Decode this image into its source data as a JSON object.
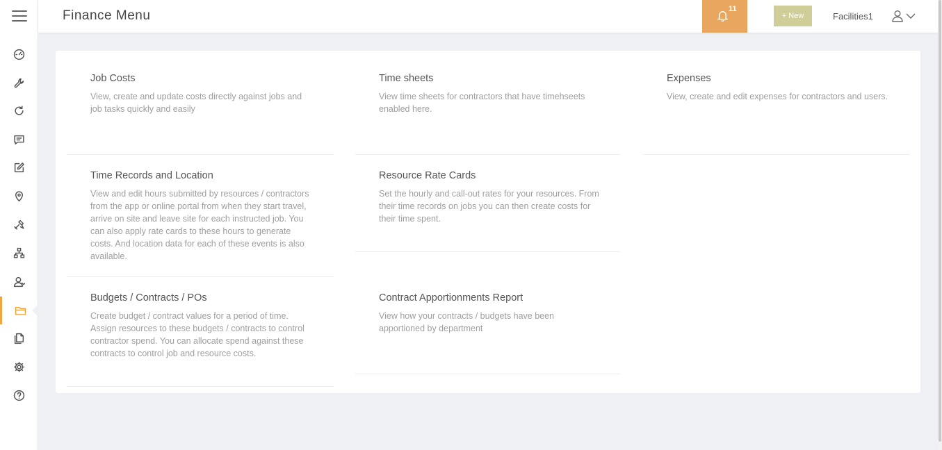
{
  "header": {
    "title": "Finance Menu",
    "notifications_count": "11",
    "new_label": "+ New",
    "user_name": "Facilities1"
  },
  "sidebar": {
    "items": [
      {
        "icon": "dashboard-icon"
      },
      {
        "icon": "wrench-icon"
      },
      {
        "icon": "refresh-icon"
      },
      {
        "icon": "message-icon"
      },
      {
        "icon": "edit-icon"
      },
      {
        "icon": "location-pin-icon"
      },
      {
        "icon": "tools-icon"
      },
      {
        "icon": "hierarchy-icon"
      },
      {
        "icon": "contractor-icon"
      },
      {
        "icon": "folder-icon",
        "active": true
      },
      {
        "icon": "documents-icon"
      },
      {
        "icon": "gear-icon"
      },
      {
        "icon": "help-icon"
      }
    ]
  },
  "colors": {
    "accent": "#f0a541",
    "bell_bg": "#e8a65f",
    "new_bg": "#cfcd98"
  },
  "menu": [
    {
      "title": "Job Costs",
      "description": "View, create and update costs directly against jobs and job tasks quickly and easily"
    },
    {
      "title": "Time sheets",
      "description": "View time sheets for contractors that have timehseets enabled here."
    },
    {
      "title": "Expenses",
      "description": "View, create and edit expenses for contractors and users."
    },
    {
      "title": "Time Records and Location",
      "description": "View and edit hours submitted by resources / contractors from the app or online portal from when they start travel, arrive on site and leave site for each instructed job. You can also apply rate cards to these hours to generate costs. And location data for each of these events is also available."
    },
    {
      "title": "Resource Rate Cards",
      "description": "Set the hourly and call-out rates for your resources. From their time records on jobs you can then create costs for their time spent."
    },
    {
      "title": "Budgets / Contracts / POs",
      "description": "Create budget / contract values for a period of time. Assign resources to these budgets / contracts to control contractor spend. You can allocate spend against these contracts to control job and resource costs."
    },
    {
      "title": "Contract Apportionments Report",
      "description": "View how your contracts / budgets have been apportioned by department"
    }
  ]
}
